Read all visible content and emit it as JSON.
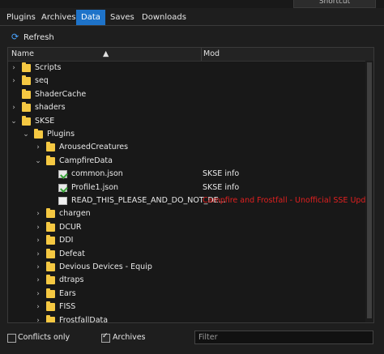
{
  "window": {
    "shortcut_label": "Shortcut"
  },
  "tabs": [
    {
      "label": "Plugins"
    },
    {
      "label": "Archives"
    },
    {
      "label": "Data"
    },
    {
      "label": "Saves"
    },
    {
      "label": "Downloads"
    }
  ],
  "toolbar": {
    "refresh_label": "Refresh",
    "refresh_icon": "refresh-icon"
  },
  "tree": {
    "columns": {
      "name": "Name",
      "mod": "Mod"
    },
    "rows": [
      {
        "name": "Scripts",
        "mod": "",
        "type": "folder",
        "depth": 0,
        "expanded": false
      },
      {
        "name": "seq",
        "mod": "",
        "type": "folder",
        "depth": 0,
        "expanded": false
      },
      {
        "name": "ShaderCache",
        "mod": "",
        "type": "folder",
        "depth": 0,
        "expanded": null
      },
      {
        "name": "shaders",
        "mod": "",
        "type": "folder",
        "depth": 0,
        "expanded": false
      },
      {
        "name": "SKSE",
        "mod": "",
        "type": "folder",
        "depth": 0,
        "expanded": true
      },
      {
        "name": "Plugins",
        "mod": "",
        "type": "folder",
        "depth": 1,
        "expanded": true
      },
      {
        "name": "ArousedCreatures",
        "mod": "",
        "type": "folder",
        "depth": 2,
        "expanded": false
      },
      {
        "name": "CampfireData",
        "mod": "",
        "type": "folder",
        "depth": 2,
        "expanded": true
      },
      {
        "name": "common.json",
        "mod": "SKSE info",
        "type": "json",
        "depth": 3,
        "expanded": null
      },
      {
        "name": "Profile1.json",
        "mod": "SKSE info",
        "type": "json",
        "depth": 3,
        "expanded": null
      },
      {
        "name": "READ_THIS_PLEASE_AND_DO_NOT_DE...",
        "mod": "Campfire and Frostfall - Unofficial SSE Update",
        "type": "plain",
        "depth": 3,
        "expanded": null,
        "conflict": true
      },
      {
        "name": "chargen",
        "mod": "",
        "type": "folder",
        "depth": 2,
        "expanded": false
      },
      {
        "name": "DCUR",
        "mod": "",
        "type": "folder",
        "depth": 2,
        "expanded": false
      },
      {
        "name": "DDI",
        "mod": "",
        "type": "folder",
        "depth": 2,
        "expanded": false
      },
      {
        "name": "Defeat",
        "mod": "",
        "type": "folder",
        "depth": 2,
        "expanded": false
      },
      {
        "name": "Devious Devices - Equip",
        "mod": "",
        "type": "folder",
        "depth": 2,
        "expanded": false
      },
      {
        "name": "dtraps",
        "mod": "",
        "type": "folder",
        "depth": 2,
        "expanded": false
      },
      {
        "name": "Ears",
        "mod": "",
        "type": "folder",
        "depth": 2,
        "expanded": false
      },
      {
        "name": "FISS",
        "mod": "",
        "type": "folder",
        "depth": 2,
        "expanded": false
      },
      {
        "name": "FrostfallData",
        "mod": "",
        "type": "folder",
        "depth": 2,
        "expanded": false
      }
    ]
  },
  "bottom": {
    "conflicts_label": "Conflicts only",
    "conflicts_checked": false,
    "archives_label": "Archives",
    "archives_checked": true,
    "filter_placeholder": "Filter"
  },
  "colors": {
    "accent": "#1e73c9",
    "folder": "#f5c842",
    "conflict": "#e02020"
  }
}
